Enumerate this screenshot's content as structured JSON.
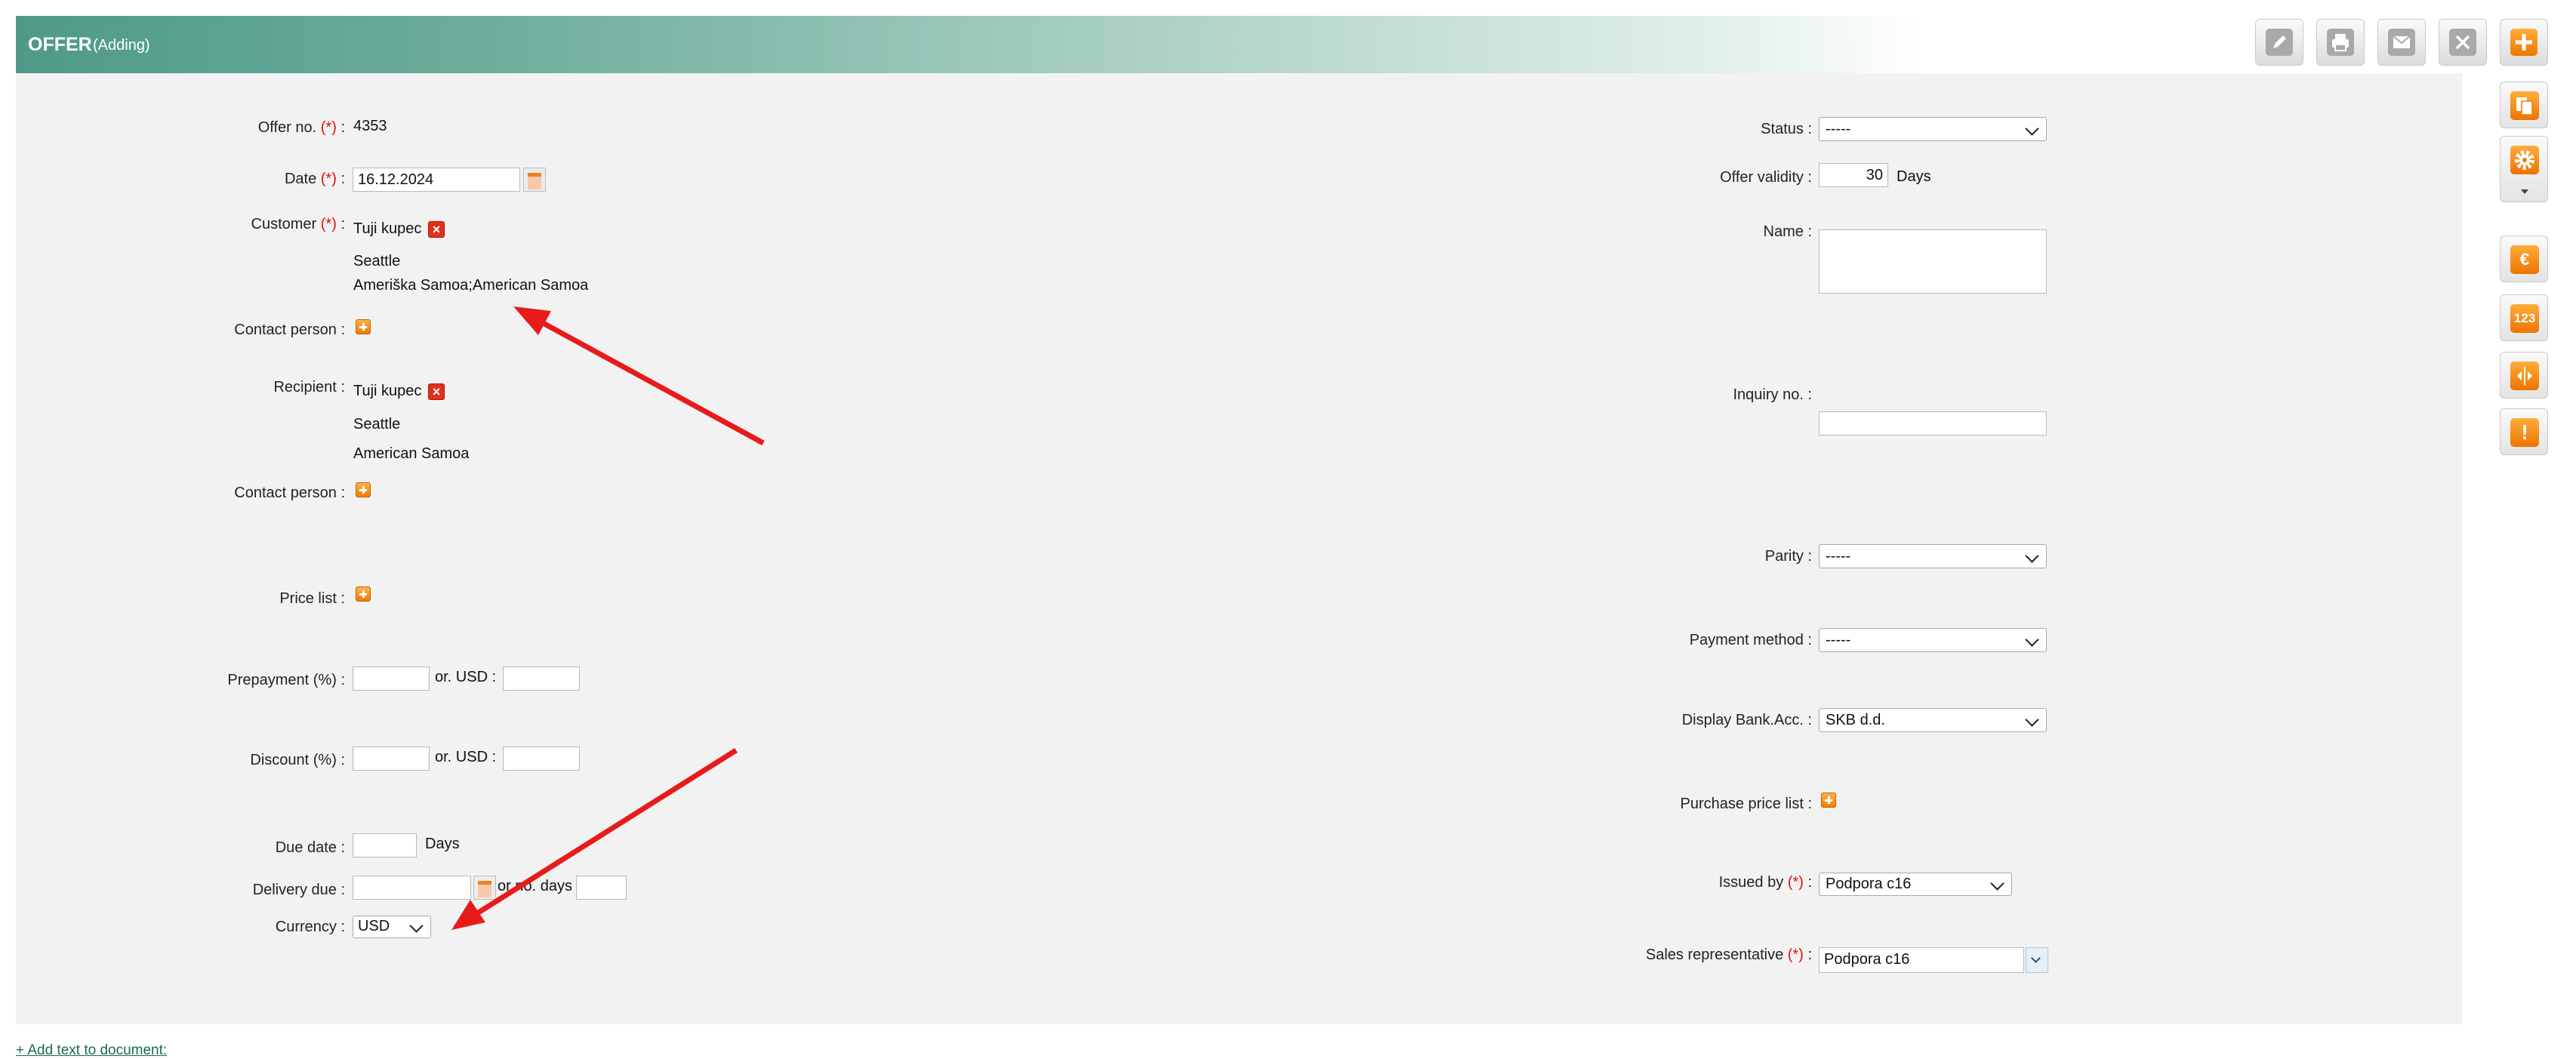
{
  "header": {
    "title": "OFFER",
    "subtitle": "(Adding)"
  },
  "toolbar": {
    "edit_icon": "pencil-icon",
    "print_icon": "printer-icon",
    "email_icon": "envelope-icon",
    "close_icon": "close-icon",
    "add_icon": "plus-icon"
  },
  "side_tools": [
    "copy-icon",
    "gear-icon",
    "euro-icon",
    "numbers-icon",
    "split-icon",
    "warning-icon"
  ],
  "left": {
    "offer_no_label": "Offer no.",
    "offer_no_value": "4353",
    "date_label": "Date",
    "date_value": "16.12.2024",
    "customer_label": "Customer",
    "customer_name": "Tuji kupec",
    "customer_city": "Seattle",
    "customer_country": "Ameriška Samoa;American Samoa",
    "contact_person_label": "Contact person :",
    "recipient_label": "Recipient",
    "recipient_name": "Tuji kupec",
    "recipient_city": "Seattle",
    "recipient_country": "American Samoa",
    "contact_person2_label": "Contact person :",
    "price_list_label": "Price list :",
    "prepayment_label": "Prepayment (%) :",
    "or_usd_1": "or. USD :",
    "discount_label": "Discount (%) :",
    "or_usd_2": "or. USD :",
    "due_date_label": "Due date :",
    "days_label": "Days",
    "delivery_due_label": "Delivery due :",
    "or_no_days": "or no. days",
    "currency_label": "Currency :",
    "currency_value": "USD",
    "required_mark": "(*)",
    "colon": ":"
  },
  "right": {
    "status_label": "Status :",
    "status_value": "-----",
    "offer_validity_label": "Offer validity :",
    "offer_validity_value": "30",
    "offer_validity_unit": "Days",
    "name_label": "Name :",
    "inquiry_label": "Inquiry no. :",
    "parity_label": "Parity :",
    "parity_value": "-----",
    "payment_method_label": "Payment method :",
    "payment_method_value": "-----",
    "bank_acc_label": "Display Bank.Acc. :",
    "bank_acc_value": "SKB d.d.",
    "purchase_price_list_label": "Purchase price list :",
    "issued_by_label": "Issued by",
    "issued_by_value": "Podpora c16",
    "sales_rep_label": "Sales representative",
    "sales_rep_value": "Podpora c16"
  },
  "footer": {
    "add_text_link": "+ Add text to document:"
  },
  "colors": {
    "header_start": "#4e9a87",
    "panel_bg": "#f2f2f2",
    "accent_orange": "#f07c00",
    "required_red": "#e01010",
    "arrow_red": "#e81b1b"
  }
}
